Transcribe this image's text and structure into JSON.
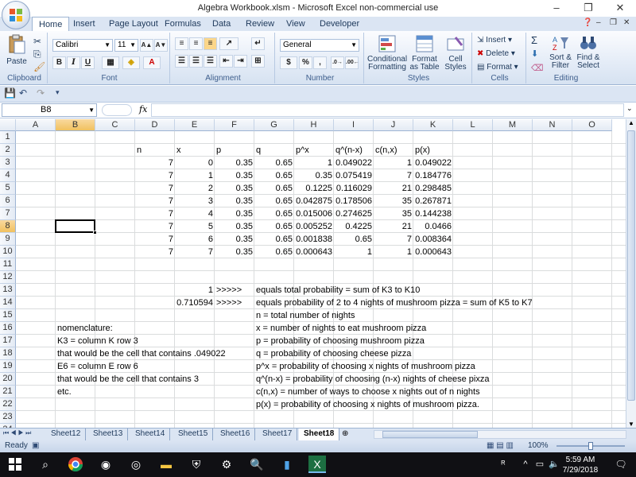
{
  "window": {
    "title": "Algebra Workbook.xlsm - Microsoft Excel non-commercial use",
    "controls": [
      "–",
      "❐",
      "✕"
    ]
  },
  "ribbon_tabs": [
    "Home",
    "Insert",
    "Page Layout",
    "Formulas",
    "Data",
    "Review",
    "View",
    "Developer"
  ],
  "ribbon": {
    "clipboard": {
      "label": "Clipboard",
      "paste": "Paste"
    },
    "font": {
      "label": "Font",
      "name": "Calibri",
      "size": "11",
      "bold": "B",
      "italic": "I",
      "underline": "U"
    },
    "alignment": {
      "label": "Alignment"
    },
    "number": {
      "label": "Number",
      "format": "General",
      "currency": "$",
      "percent": "%",
      "comma": ","
    },
    "styles": {
      "label": "Styles",
      "conditional": "Conditional Formatting",
      "as_table": "Format as Table",
      "cell_styles": "Cell Styles"
    },
    "cells": {
      "label": "Cells",
      "insert": "Insert",
      "delete": "Delete",
      "format": "Format"
    },
    "editing": {
      "label": "Editing",
      "sort": "Sort & Filter",
      "find": "Find & Select"
    }
  },
  "formula_bar": {
    "name_box": "B8",
    "fx": "fx",
    "content": ""
  },
  "columns": [
    "A",
    "B",
    "C",
    "D",
    "E",
    "F",
    "G",
    "H",
    "I",
    "J",
    "K",
    "L",
    "M",
    "N",
    "O"
  ],
  "rows": [
    "1",
    "2",
    "3",
    "4",
    "5",
    "6",
    "7",
    "8",
    "9",
    "10",
    "11",
    "12",
    "13",
    "14",
    "15",
    "16",
    "17",
    "18",
    "19",
    "20",
    "21",
    "22",
    "23",
    "24"
  ],
  "table": {
    "headers": [
      "n",
      "x",
      "p",
      "q",
      "p^x",
      "q^(n-x)",
      "c(n,x)",
      "p(x)"
    ],
    "data": [
      [
        "7",
        "0",
        "0.35",
        "0.65",
        "1",
        "0.049022",
        "1",
        "0.049022"
      ],
      [
        "7",
        "1",
        "0.35",
        "0.65",
        "0.35",
        "0.075419",
        "7",
        "0.184776"
      ],
      [
        "7",
        "2",
        "0.35",
        "0.65",
        "0.1225",
        "0.116029",
        "21",
        "0.298485"
      ],
      [
        "7",
        "3",
        "0.35",
        "0.65",
        "0.042875",
        "0.178506",
        "35",
        "0.267871"
      ],
      [
        "7",
        "4",
        "0.35",
        "0.65",
        "0.015006",
        "0.274625",
        "35",
        "0.144238"
      ],
      [
        "7",
        "5",
        "0.35",
        "0.65",
        "0.005252",
        "0.4225",
        "21",
        "0.0466"
      ],
      [
        "7",
        "6",
        "0.35",
        "0.65",
        "0.001838",
        "0.65",
        "7",
        "0.008364"
      ],
      [
        "7",
        "7",
        "0.35",
        "0.65",
        "0.000643",
        "1",
        "1",
        "0.000643"
      ]
    ]
  },
  "summary": {
    "row13": {
      "value": "1",
      "arrow": ">>>>>",
      "text": "equals total probability = sum of K3 to K10"
    },
    "row14": {
      "value": "0.710594",
      "arrow": ">>>>>",
      "text": "equals probability of 2 to 4 nights of mushroom pizza = sum of K5 to K7"
    }
  },
  "notes_right": [
    "n = total number of nights",
    "x = number of nights to eat mushroom pizza",
    "p = probability of choosing mushroom pizza",
    "q = probability of choosing cheese pizza",
    "p^x = probability of choosing x nights of mushroom pizza",
    "q^(n-x) = probability of choosing (n-x) nights of cheese pixza",
    "c(n,x) = number of ways to choose x nights out of n nights",
    "p(x) = probability of choosing x nights of mushroom pizza."
  ],
  "notes_left": [
    "nomenclature:",
    "K3 = column K row 3",
    "that would be the cell that contains .049022",
    "E6 = column E row 6",
    "that would be the cell that contains 3",
    "etc."
  ],
  "sheet_tabs": [
    "Sheet12",
    "Sheet13",
    "Sheet14",
    "Sheet15",
    "Sheet16",
    "Sheet17",
    "Sheet18"
  ],
  "active_sheet": "Sheet18",
  "status": {
    "ready": "Ready",
    "zoom": "100%"
  },
  "taskbar": {
    "time": "5:59 AM",
    "date": "7/29/2018"
  }
}
